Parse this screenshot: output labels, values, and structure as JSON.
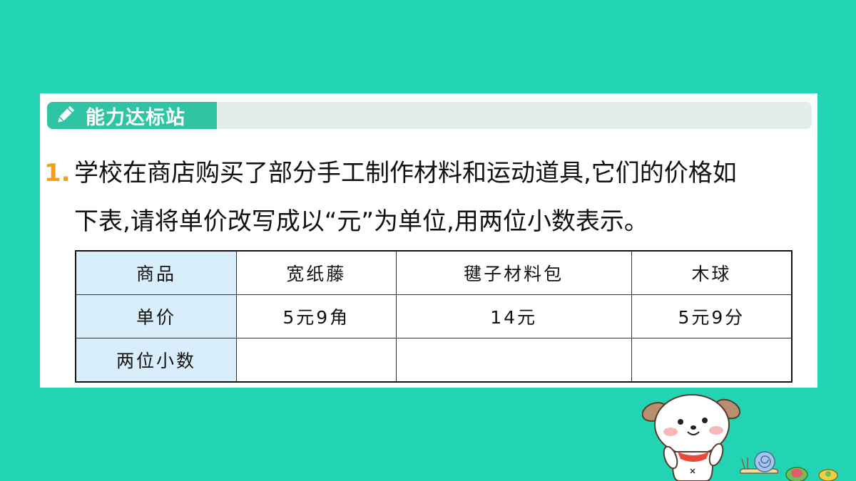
{
  "section": {
    "title": "能力达标站",
    "icon": "pencil-icon"
  },
  "question": {
    "number": "1.",
    "line1": "学校在商店购买了部分手工制作材料和运动道具,它们的价格如",
    "line2": "下表,请将单价改写成以“元”为单位,用两位小数表示。"
  },
  "table": {
    "row_headers": [
      "商品",
      "单价",
      "两位小数"
    ],
    "items": [
      "宽纸藤",
      "毽子材料包",
      "木球"
    ],
    "prices": [
      "5元9角",
      "14元",
      "5元9分"
    ],
    "decimals": [
      "",
      "",
      ""
    ]
  },
  "colors": {
    "background": "#22d4b4",
    "section_tag": "#2ec4a4",
    "question_number": "#f0a020",
    "header_cell": "#d8eefa"
  }
}
